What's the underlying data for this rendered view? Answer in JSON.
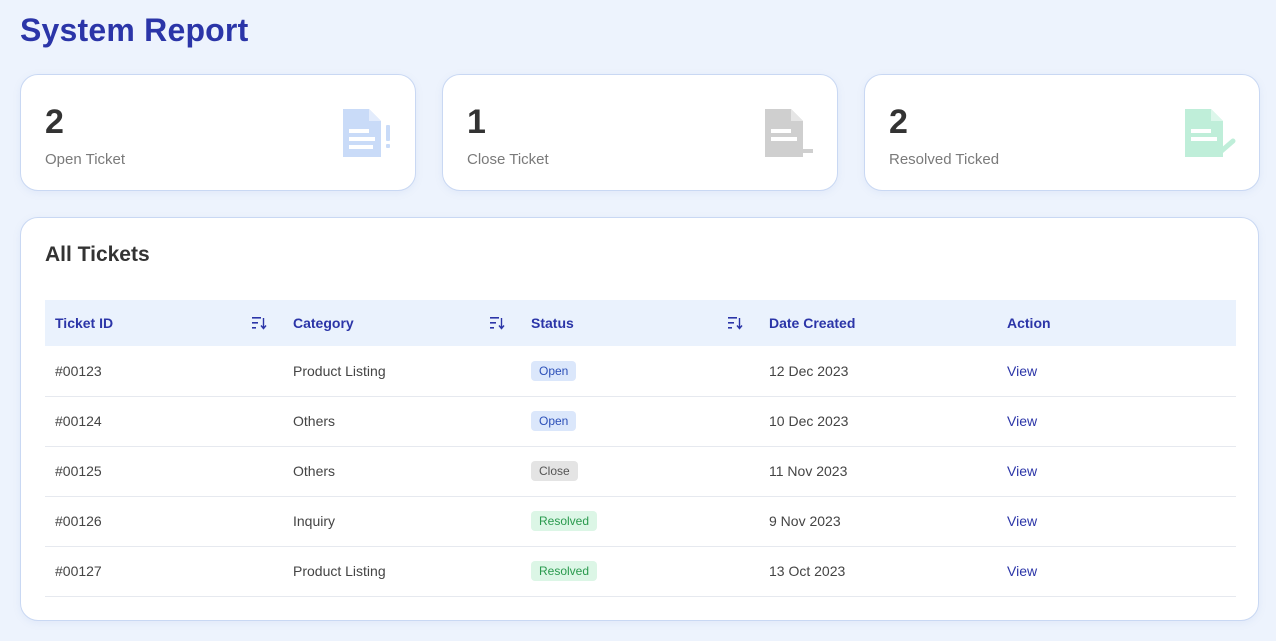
{
  "page": {
    "title": "System Report"
  },
  "cards": [
    {
      "count": "2",
      "label": "Open Ticket",
      "icon": "document-alert-icon",
      "color": "#c9dbf8"
    },
    {
      "count": "1",
      "label": "Close Ticket",
      "icon": "document-remove-icon",
      "color": "#cfcfcf"
    },
    {
      "count": "2",
      "label": "Resolved Ticked",
      "icon": "document-check-icon",
      "color": "#bfeed9"
    }
  ],
  "tickets": {
    "title": "All Tickets",
    "columns": [
      "Ticket ID",
      "Category",
      "Status",
      "Date Created",
      "Action"
    ],
    "rows": [
      {
        "id": "#00123",
        "category": "Product Listing",
        "status": "Open",
        "date": "12 Dec 2023",
        "action": "View"
      },
      {
        "id": "#00124",
        "category": "Others",
        "status": "Open",
        "date": "10 Dec 2023",
        "action": "View"
      },
      {
        "id": "#00125",
        "category": "Others",
        "status": "Close",
        "date": "11 Nov 2023",
        "action": "View"
      },
      {
        "id": "#00126",
        "category": "Inquiry",
        "status": "Resolved",
        "date": "9 Nov 2023",
        "action": "View"
      },
      {
        "id": "#00127",
        "category": "Product Listing",
        "status": "Resolved",
        "date": "13 Oct 2023",
        "action": "View"
      }
    ]
  },
  "colors": {
    "accent": "#2b35a8",
    "open_badge": "#dbe7fb",
    "close_badge": "#e4e4e4",
    "resolved_badge": "#dcf6e6"
  }
}
